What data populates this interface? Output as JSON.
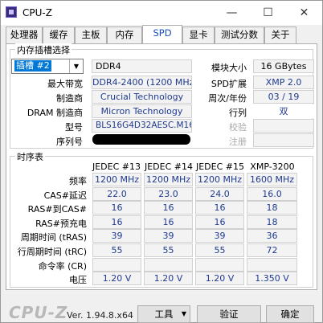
{
  "window": {
    "title": "CPU-Z",
    "min": "—",
    "max": "☐",
    "close": "✕"
  },
  "tabs": [
    {
      "label": "处理器"
    },
    {
      "label": "缓存"
    },
    {
      "label": "主板"
    },
    {
      "label": "内存"
    },
    {
      "label": "SPD"
    },
    {
      "label": "显卡"
    },
    {
      "label": "测试分数"
    },
    {
      "label": "关于"
    }
  ],
  "slot_group": {
    "title": "内存插槽选择",
    "slot": "插槽 #2",
    "type": "DDR4",
    "module_size_label": "模块大小",
    "module_size": "16 GBytes",
    "max_bw_label": "最大带宽",
    "max_bw": "DDR4-2400 (1200 MHz)",
    "spd_ext_label": "SPD扩展",
    "spd_ext": "XMP 2.0",
    "manufacturer_label": "制造商",
    "manufacturer": "Crucial Technology",
    "week_year_label": "周次/年份",
    "week_year": "03 / 19",
    "dram_label": "DRAM 制造商",
    "dram": "Micron Technology",
    "rank_label": "行列",
    "rank": "双",
    "part_label": "型号",
    "part": "BLS16G4D32AESC.M16FE",
    "check_label": "校验",
    "serial_label": "序列号",
    "reg_label": "注册"
  },
  "timings": {
    "title": "时序表",
    "columns": [
      "JEDEC #13",
      "JEDEC #14",
      "JEDEC #15",
      "XMP-3200"
    ],
    "rows": [
      {
        "label": "频率",
        "values": [
          "1200 MHz",
          "1200 MHz",
          "1200 MHz",
          "1600 MHz"
        ]
      },
      {
        "label": "CAS#延迟",
        "values": [
          "22.0",
          "23.0",
          "24.0",
          "16.0"
        ]
      },
      {
        "label": "RAS#到CAS#",
        "values": [
          "16",
          "16",
          "16",
          "18"
        ]
      },
      {
        "label": "RAS#预充电",
        "values": [
          "16",
          "16",
          "16",
          "18"
        ]
      },
      {
        "label": "周期时间 (tRAS)",
        "values": [
          "39",
          "39",
          "39",
          "36"
        ]
      },
      {
        "label": "行周期时间 (tRC)",
        "values": [
          "55",
          "55",
          "55",
          "72"
        ]
      },
      {
        "label": "命令率 (CR)",
        "values": [
          "",
          "",
          "",
          ""
        ]
      },
      {
        "label": "电压",
        "values": [
          "1.20 V",
          "1.20 V",
          "1.20 V",
          "1.350 V"
        ]
      }
    ]
  },
  "footer": {
    "logo": "CPU-Z",
    "version": "Ver. 1.94.8.x64",
    "tools": "工具",
    "validate": "验证",
    "ok": "确定"
  }
}
